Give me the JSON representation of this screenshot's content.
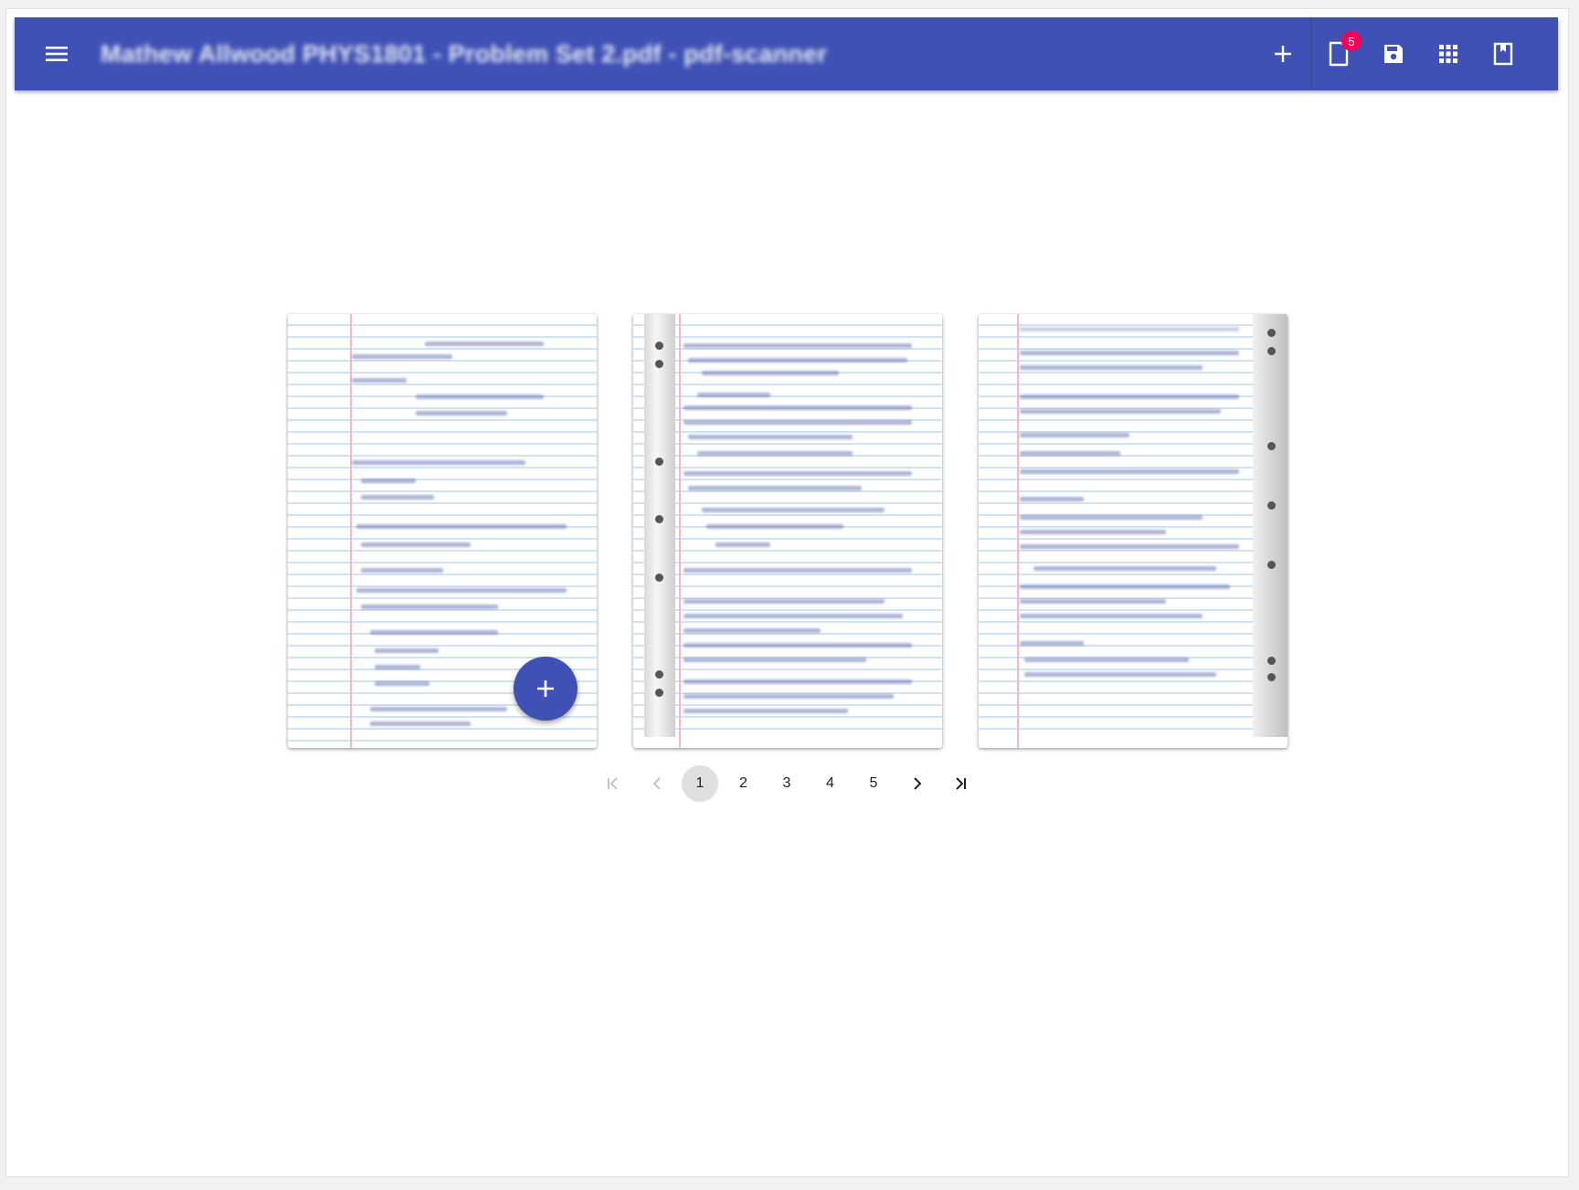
{
  "app": {
    "title": "Mathew Allwood PHYS1801 - Problem Set 2.pdf - pdf-scanner",
    "accent_color": "#3f51b5",
    "badge_color": "#f50057"
  },
  "toolbar": {
    "menu_icon": "menu-icon",
    "actions": [
      {
        "name": "add-icon"
      },
      {
        "name": "document-icon",
        "badge": "5"
      },
      {
        "name": "save-icon"
      },
      {
        "name": "grid-view-icon"
      },
      {
        "name": "bookmark-icon"
      }
    ]
  },
  "pages": [
    {
      "label": "page-1"
    },
    {
      "label": "page-2"
    },
    {
      "label": "page-3"
    }
  ],
  "fab": {
    "icon": "add-icon"
  },
  "pagination": {
    "current": 1,
    "pages": [
      "1",
      "2",
      "3",
      "4",
      "5"
    ]
  }
}
